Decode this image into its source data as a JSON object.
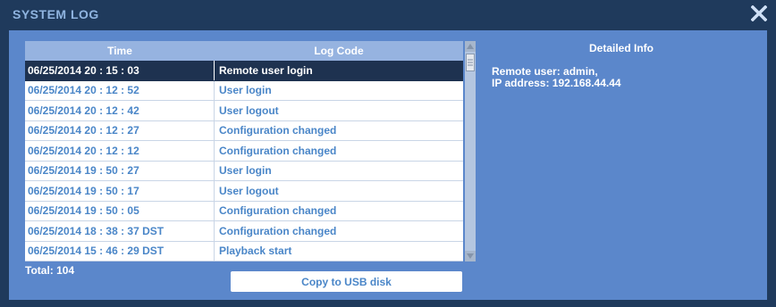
{
  "window": {
    "title": "SYSTEM LOG",
    "close_icon": "close-icon"
  },
  "log_table": {
    "columns": {
      "time": "Time",
      "log_code": "Log Code"
    },
    "rows": [
      {
        "time": "06/25/2014  20 : 15 : 03",
        "code": "Remote user login",
        "selected": true
      },
      {
        "time": "06/25/2014  20 : 12 : 52",
        "code": "User login"
      },
      {
        "time": "06/25/2014  20 : 12 : 42",
        "code": "User logout"
      },
      {
        "time": "06/25/2014  20 : 12 : 27",
        "code": "Configuration changed"
      },
      {
        "time": "06/25/2014  20 : 12 : 12",
        "code": "Configuration changed"
      },
      {
        "time": "06/25/2014  19 : 50 : 27",
        "code": "User login"
      },
      {
        "time": "06/25/2014  19 : 50 : 17",
        "code": "User logout"
      },
      {
        "time": "06/25/2014  19 : 50 : 05",
        "code": "Configuration changed"
      },
      {
        "time": "06/25/2014  18 : 38 : 37  DST",
        "code": "Configuration changed"
      },
      {
        "time": "06/25/2014  15 : 46 : 29  DST",
        "code": "Playback start"
      }
    ]
  },
  "total_label": "Total: 104",
  "copy_button_label": "Copy to USB disk",
  "detail": {
    "title": "Detailed Info",
    "line1": "Remote user: admin,",
    "line2": "IP address: 192.168.44.44"
  },
  "colors": {
    "frame": "#1f3a5c",
    "panel": "#5b87cb",
    "header": "#96b3e0",
    "selected_row": "#1e3250",
    "row_text": "#4a86c8"
  }
}
